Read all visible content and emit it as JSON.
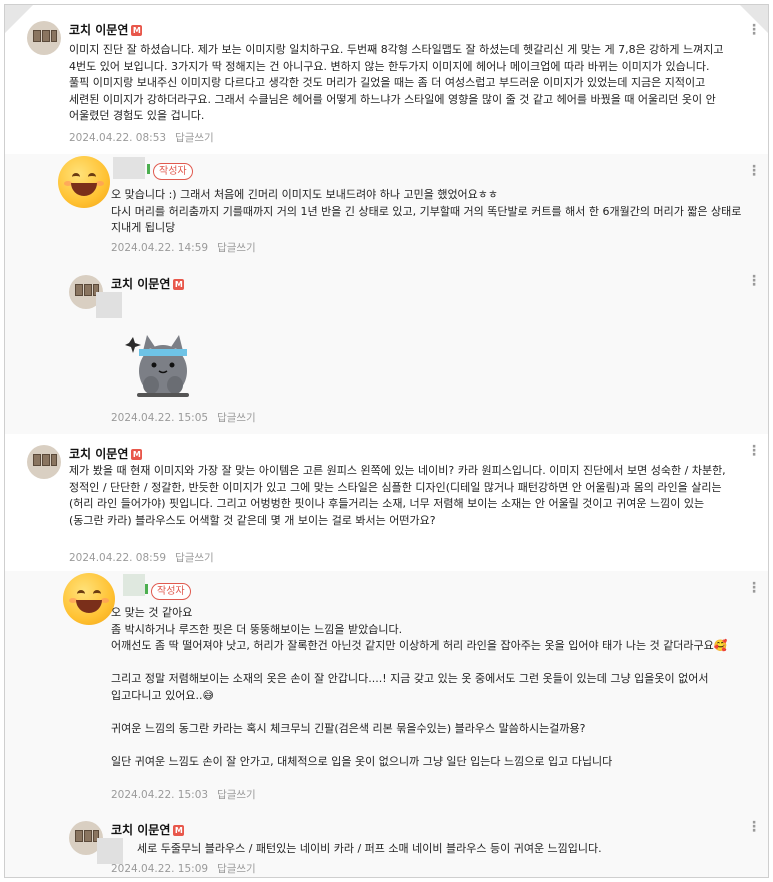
{
  "comments": [
    {
      "nickname": "코치 이문연",
      "badge": "M",
      "text": "이미지 진단 잘 하셨습니다. 제가 보는 이미지랑 일치하구요. 두번째 8각형 스타일맵도 잘 하셨는데 헷갈리신 게 맞는 게 7,8은 강하게 느껴지고 4번도 있어 보입니다. 3가지가 딱 정해지는 건 아니구요. 변하지 않는 한두가지 이미지에 헤어나 메이크업에 따라 바뀌는 이미지가 있습니다. 풀픽 이미지랑 보내주신 이미지랑 다르다고 생각한 것도 머리가 길었을 때는 좀 더 여성스럽고 부드러운 이미지가 있었는데 지금은 지적이고 세련된 이미지가 강하더라구요. 그래서 수클님은 헤어를 어떻게 하느냐가 스타일에 영향을 많이 줄 것 같고 헤어를 바꿨을 때 어울리던 옷이 안 어울렸던 경험도 있을 겁니다.",
      "date": "2024.04.22. 08:53",
      "reply_label": "답글쓰기"
    },
    {
      "author_badge": "작성자",
      "text": "오 맞습니다 :) 그래서 처음에 긴머리 이미지도 보내드려야 하나 고민을 했었어요ㅎㅎ\n다시 머리를 허리춤까지 기를때까지 거의 1년 반을 긴 상태로 있고, 기부할때 거의 똑단발로 커트를 해서 한 6개월간의 머리가 짧은 상태로 지내게 됩니당",
      "date": "2024.04.22. 14:59",
      "reply_label": "답글쓰기"
    },
    {
      "nickname": "코치 이문연",
      "badge": "M",
      "date": "2024.04.22. 15:05",
      "reply_label": "답글쓰기"
    },
    {
      "nickname": "코치 이문연",
      "badge": "M",
      "text": "제가 봤을 때 현재 이미지와 가장 잘 맞는 아이템은 고른 원피스 왼쪽에 있는 네이비? 카라 원피스입니다. 이미지 진단에서 보면 성숙한 / 차분한, 정적인 / 단단한 / 정갈한, 반듯한 이미지가 있고 그에 맞는 스타일은 심플한 디자인(디테일 많거나 패턴강하면 안 어울림)과 몸의 라인을 살리는(허리 라인 들어가야) 핏입니다. 그리고 어벙벙한 핏이나 후들거리는 소재, 너무 저렴해 보이는 소재는 안 어울릴 것이고 귀여운 느낌이 있는(동그란 카라) 블라우스도 어색할 것 같은데 몇 개 보이는 걸로 봐서는 어떤가요?",
      "date": "2024.04.22. 08:59",
      "reply_label": "답글쓰기"
    },
    {
      "author_badge": "작성자",
      "text": "오 맞는 것 같아요\n좀 박시하거나 루즈한 핏은 더 뚱뚱해보이는 느낌을 받았습니다.\n어깨선도 좀 딱 떨어져야 낫고, 허리가 잘록한건 아닌것 같지만 이상하게 허리 라인을 잡아주는 옷을 입어야 태가 나는 것 같더라구요🥰\n\n그리고 정말 저렴해보이는 소재의 옷은 손이 잘 안갑니다....! 지금 갖고 있는 옷 중에서도 그런 옷들이 있는데 그냥 입을옷이 없어서 입고다니고 있어요..😅\n\n귀여운 느낌의 동그란 카라는 혹시 체크무늬 긴팔(검은색 리본 묶을수있는) 블라우스 말씀하시는걸까용?\n\n일단 귀여운 느낌도 손이 잘 안가고, 대체적으로 입을 옷이 없으니까 그냥 일단 입는다 느낌으로 입고 다닙니다",
      "date": "2024.04.22. 15:03",
      "reply_label": "답글쓰기"
    },
    {
      "nickname": "코치 이문연",
      "badge": "M",
      "text": "세로 두줄무늬 블라우스 / 패턴있는 네이비 카라 / 퍼프 소매 네이비 블라우스 등이 귀여운 느낌입니다.",
      "date": "2024.04.22. 15:09",
      "reply_label": "답글쓰기"
    }
  ],
  "more_icon": "⋮"
}
